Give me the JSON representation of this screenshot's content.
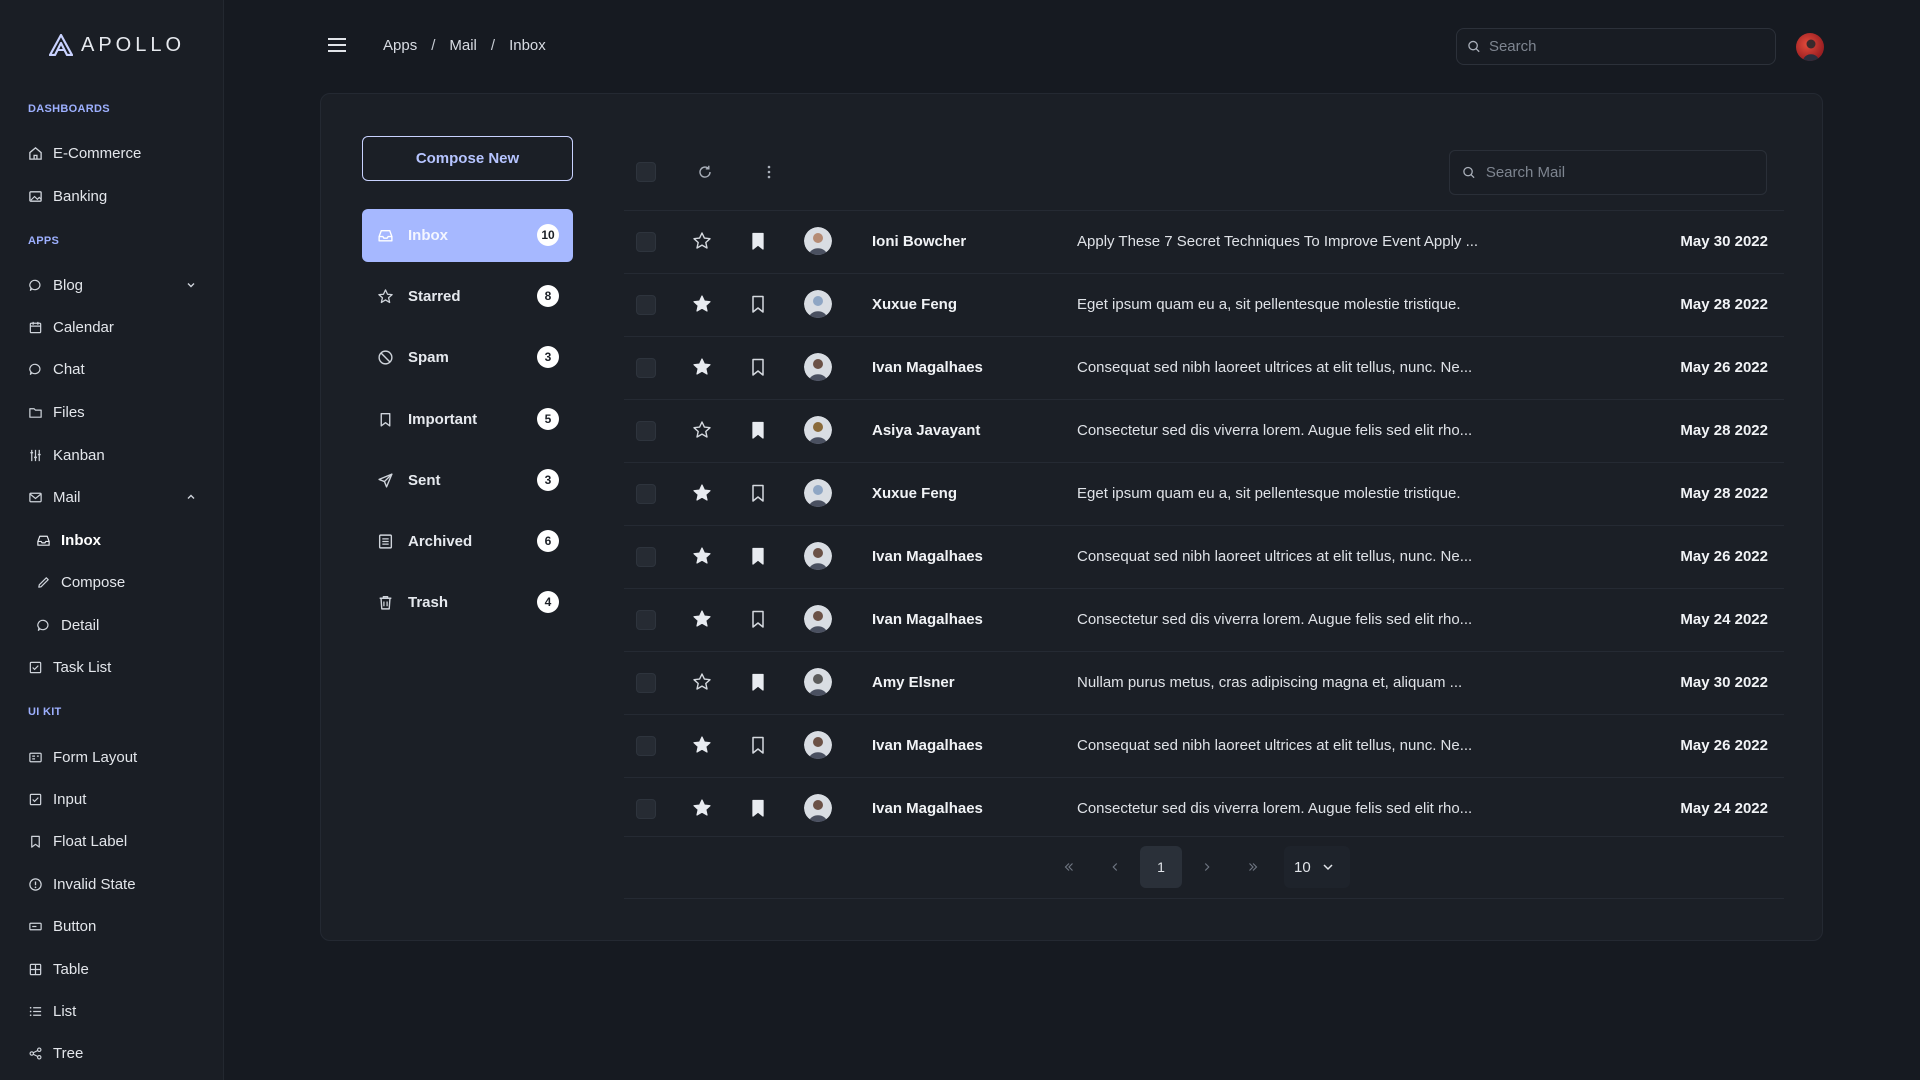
{
  "brand": {
    "name": "APOLLO"
  },
  "sidebar": {
    "sections": [
      {
        "title": "DASHBOARDS"
      },
      {
        "title": "APPS"
      },
      {
        "title": "UI KIT"
      }
    ],
    "items": [
      {
        "label": "E-Commerce",
        "icon": "home-icon"
      },
      {
        "label": "Banking",
        "icon": "image-icon"
      },
      {
        "label": "Blog",
        "icon": "comment-icon"
      },
      {
        "label": "Calendar",
        "icon": "calendar-icon"
      },
      {
        "label": "Chat",
        "icon": "chat-icon"
      },
      {
        "label": "Files",
        "icon": "folder-icon"
      },
      {
        "label": "Kanban",
        "icon": "sliders-icon"
      },
      {
        "label": "Mail",
        "icon": "envelope-icon"
      },
      {
        "label": "Inbox",
        "icon": "inbox-icon"
      },
      {
        "label": "Compose",
        "icon": "pencil-icon"
      },
      {
        "label": "Detail",
        "icon": "comment-icon"
      },
      {
        "label": "Task List",
        "icon": "check-square-icon"
      },
      {
        "label": "Form Layout",
        "icon": "id-card-icon"
      },
      {
        "label": "Input",
        "icon": "check-square-icon"
      },
      {
        "label": "Float Label",
        "icon": "bookmark-icon"
      },
      {
        "label": "Invalid State",
        "icon": "exclamation-circle-icon"
      },
      {
        "label": "Button",
        "icon": "box-icon"
      },
      {
        "label": "Table",
        "icon": "table-icon"
      },
      {
        "label": "List",
        "icon": "list-icon"
      },
      {
        "label": "Tree",
        "icon": "share-icon"
      }
    ]
  },
  "topbar": {
    "breadcrumb": [
      "Apps",
      "/",
      "Mail",
      "/",
      "Inbox"
    ],
    "search_placeholder": "Search"
  },
  "mail": {
    "compose_label": "Compose New",
    "folders": [
      {
        "label": "Inbox",
        "count": "10",
        "icon": "inbox-icon"
      },
      {
        "label": "Starred",
        "count": "8",
        "icon": "star-icon"
      },
      {
        "label": "Spam",
        "count": "3",
        "icon": "ban-icon"
      },
      {
        "label": "Important",
        "count": "5",
        "icon": "bookmark-icon"
      },
      {
        "label": "Sent",
        "count": "3",
        "icon": "send-icon"
      },
      {
        "label": "Archived",
        "count": "6",
        "icon": "archive-icon"
      },
      {
        "label": "Trash",
        "count": "4",
        "icon": "trash-icon"
      }
    ],
    "search_placeholder": "Search Mail",
    "messages": [
      {
        "sender": "Ioni Bowcher",
        "subject": "Apply These 7 Secret Techniques To Improve Event Apply ...",
        "date": "May 30 2022",
        "starred": false,
        "important": true
      },
      {
        "sender": "Xuxue Feng",
        "subject": "Eget ipsum quam eu a, sit pellentesque molestie tristique.",
        "date": "May 28 2022",
        "starred": true,
        "important": false
      },
      {
        "sender": "Ivan Magalhaes",
        "subject": "Consequat sed nibh laoreet ultrices at elit tellus, nunc. Ne...",
        "date": "May 26 2022",
        "starred": true,
        "important": false
      },
      {
        "sender": "Asiya Javayant",
        "subject": "Consectetur sed dis viverra lorem. Augue felis sed elit rho...",
        "date": "May 28 2022",
        "starred": false,
        "important": true
      },
      {
        "sender": "Xuxue Feng",
        "subject": "Eget ipsum quam eu a, sit pellentesque molestie tristique.",
        "date": "May 28 2022",
        "starred": true,
        "important": false
      },
      {
        "sender": "Ivan Magalhaes",
        "subject": "Consequat sed nibh laoreet ultrices at elit tellus, nunc. Ne...",
        "date": "May 26 2022",
        "starred": true,
        "important": true
      },
      {
        "sender": "Ivan Magalhaes",
        "subject": "Consectetur sed dis viverra lorem. Augue felis sed elit rho...",
        "date": "May 24 2022",
        "starred": true,
        "important": false
      },
      {
        "sender": "Amy Elsner",
        "subject": "Nullam purus metus, cras adipiscing magna et, aliquam ...",
        "date": "May 30 2022",
        "starred": false,
        "important": true
      },
      {
        "sender": "Ivan Magalhaes",
        "subject": "Consequat sed nibh laoreet ultrices at elit tellus, nunc. Ne...",
        "date": "May 26 2022",
        "starred": true,
        "important": false
      },
      {
        "sender": "Ivan Magalhaes",
        "subject": "Consectetur sed dis viverra lorem. Augue felis sed elit rho...",
        "date": "May 24 2022",
        "starred": true,
        "important": true
      }
    ],
    "pagination": {
      "current_page": "1",
      "rows_per_page": "10"
    }
  },
  "colors": {
    "accent": "#a6b8ff",
    "section_title": "#9db0ff",
    "background": "#161a21",
    "panel": "#1b1f26"
  }
}
